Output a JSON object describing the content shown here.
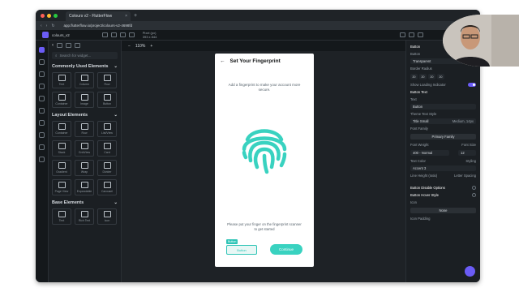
{
  "browser": {
    "tab_title": "Colours v2 - FlutterFlow",
    "url": "app.flutterflow.io/project/colours-v2-4698fd"
  },
  "appbar": {
    "project_name": "colours_v2",
    "zoom": "110%",
    "device_label": "Pixel (px)",
    "device_size": "393 x 844"
  },
  "widget_panel": {
    "search_placeholder": "Search for widget...",
    "sections": [
      "Commonly Used Elements",
      "Layout Elements",
      "Base Elements"
    ],
    "common": [
      "Text",
      "Column",
      "Row",
      "Container",
      "Image",
      "Button"
    ],
    "layout": [
      "Container",
      "Row",
      "List/View",
      "Stack",
      "Stack",
      "GridView",
      "Card",
      "Column",
      "Gradient",
      "Wrap",
      "Divider",
      "Page View",
      "Expandable",
      "Tab",
      "Carousel",
      "Wrap",
      "Spacer",
      "Tab",
      "Tab",
      "Page"
    ],
    "base": [
      "Text",
      "Rich Text",
      "Icon"
    ]
  },
  "phone": {
    "title": "Set Your Fingerprint",
    "description": "Add a fingerprint to make your account more secure.",
    "instruction": "Please put your finger on the fingerprint scanner to get started",
    "selected_tag": "Button",
    "selected_button": "Button",
    "continue_label": "Continue",
    "accent": "#39d2c0"
  },
  "properties": {
    "widget_name": "Button",
    "widget_type": "Button",
    "background_label": "Transparent",
    "border_radius_label": "Border Radius",
    "radius_values": [
      "20",
      "20",
      "20",
      "20"
    ],
    "loading_label": "Show Loading Indicator",
    "button_text_label": "Button Text",
    "text_label": "Text",
    "text_value": "Button",
    "theme_style_label": "Theme Text Style",
    "theme_style_value": "Title Small",
    "theme_style_weight": "Medium, 14px",
    "font_family_label": "Font Family",
    "font_family_value": "Primary Family",
    "font_weight_label": "Font Weight",
    "font_size_label": "Font Size",
    "font_weight_value": "400 - Normal",
    "font_size_value": "12",
    "text_color_label": "Text Color",
    "styling_label": "Styling",
    "text_color_value": "Accent 3",
    "line_height_label": "Line Height (ratio)",
    "letter_spacing_label": "Letter Spacing",
    "disable_options_label": "Button Disable Options",
    "hover_style_label": "Button Hover Style",
    "icon_label": "Icon",
    "icon_value": "None",
    "icon_padding_label": "Icon Padding",
    "accent": "#6b5cf6"
  }
}
